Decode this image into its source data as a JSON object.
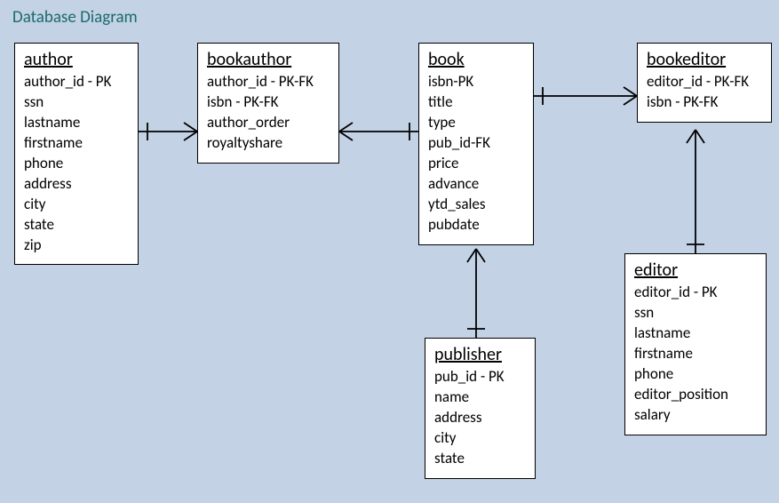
{
  "title": "Database Diagram",
  "entities": {
    "author": {
      "name": "author",
      "attrs": [
        "author_id - PK",
        "ssn",
        "lastname",
        "firstname",
        "phone",
        "address",
        "city",
        "state",
        "zip"
      ]
    },
    "bookauthor": {
      "name": "bookauthor",
      "attrs": [
        "author_id - PK-FK",
        "isbn - PK-FK",
        "author_order",
        "royaltyshare"
      ]
    },
    "book": {
      "name": "book",
      "attrs": [
        "isbn-PK",
        "title",
        "type",
        "pub_id-FK",
        "price",
        "advance",
        "ytd_sales",
        "pubdate"
      ]
    },
    "bookeditor": {
      "name": "bookeditor",
      "attrs": [
        "editor_id - PK-FK",
        "isbn - PK-FK"
      ]
    },
    "publisher": {
      "name": "publisher",
      "attrs": [
        "pub_id - PK",
        "name",
        "address",
        "city",
        "state"
      ]
    },
    "editor": {
      "name": "editor",
      "attrs": [
        "editor_id - PK",
        "ssn",
        "lastname",
        "firstname",
        "phone",
        "editor_position",
        "salary"
      ]
    }
  },
  "relationships": [
    {
      "from": "author",
      "to": "bookauthor",
      "cardinality": "one-to-many"
    },
    {
      "from": "book",
      "to": "bookauthor",
      "cardinality": "one-to-many"
    },
    {
      "from": "book",
      "to": "bookeditor",
      "cardinality": "one-to-many"
    },
    {
      "from": "editor",
      "to": "bookeditor",
      "cardinality": "one-to-many"
    },
    {
      "from": "publisher",
      "to": "book",
      "cardinality": "one-to-many"
    }
  ]
}
